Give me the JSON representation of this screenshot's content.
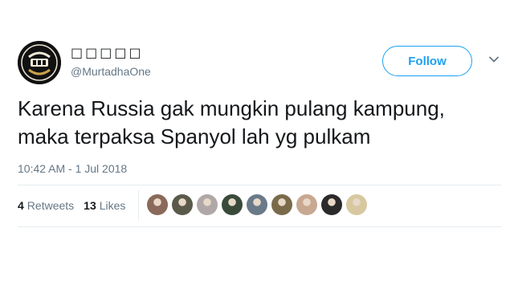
{
  "user": {
    "display_name": "□□□□□",
    "handle": "@MurtadhaOne",
    "avatar_icon": "profile-avatar-logo"
  },
  "follow_label": "Follow",
  "menu_icon": "chevron-down-icon",
  "tweet": {
    "lines": [
      "Karena Russia gak mungkin pulang kampung,",
      "maka terpaksa Spanyol lah yg pulkam"
    ],
    "timestamp": "10:42 AM - 1 Jul 2018"
  },
  "stats": {
    "retweets_count": "4",
    "retweets_label": "Retweets",
    "likes_count": "13",
    "likes_label": "Likes"
  },
  "likers": [
    {
      "icon": "liker-avatar",
      "color": "#8a6a5a"
    },
    {
      "icon": "liker-avatar",
      "color": "#5a5a4a"
    },
    {
      "icon": "liker-avatar",
      "color": "#b0a8a8"
    },
    {
      "icon": "liker-avatar",
      "color": "#3a4a3a"
    },
    {
      "icon": "liker-avatar",
      "color": "#6a7a88"
    },
    {
      "icon": "liker-avatar",
      "color": "#7a6a4a"
    },
    {
      "icon": "liker-avatar",
      "color": "#c8a890"
    },
    {
      "icon": "liker-avatar",
      "color": "#2a2a2a"
    },
    {
      "icon": "liker-avatar",
      "color": "#d8c8a0"
    }
  ],
  "colors": {
    "accent": "#1da1f2",
    "secondary_text": "#657786",
    "divider": "#e6ecf0"
  }
}
